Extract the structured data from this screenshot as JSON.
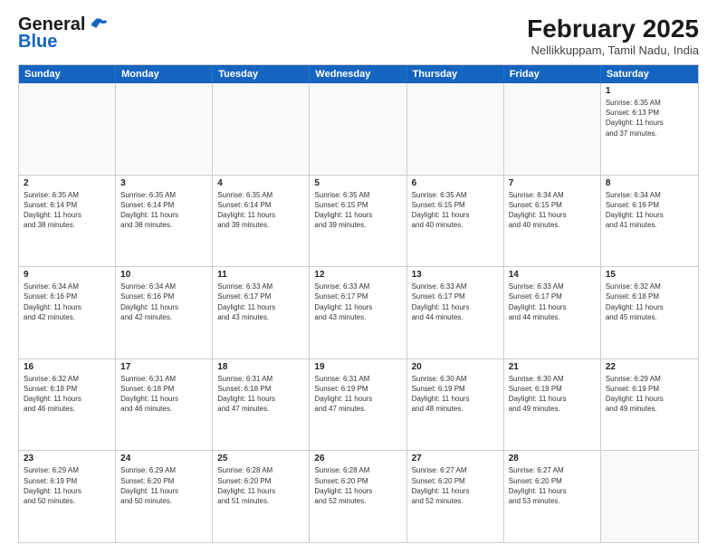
{
  "logo": {
    "line1": "General",
    "line2": "Blue"
  },
  "title": "February 2025",
  "subtitle": "Nellikkuppam, Tamil Nadu, India",
  "header_days": [
    "Sunday",
    "Monday",
    "Tuesday",
    "Wednesday",
    "Thursday",
    "Friday",
    "Saturday"
  ],
  "weeks": [
    [
      {
        "day": "",
        "info": ""
      },
      {
        "day": "",
        "info": ""
      },
      {
        "day": "",
        "info": ""
      },
      {
        "day": "",
        "info": ""
      },
      {
        "day": "",
        "info": ""
      },
      {
        "day": "",
        "info": ""
      },
      {
        "day": "1",
        "info": "Sunrise: 6:35 AM\nSunset: 6:13 PM\nDaylight: 11 hours\nand 37 minutes."
      }
    ],
    [
      {
        "day": "2",
        "info": "Sunrise: 6:35 AM\nSunset: 6:14 PM\nDaylight: 11 hours\nand 38 minutes."
      },
      {
        "day": "3",
        "info": "Sunrise: 6:35 AM\nSunset: 6:14 PM\nDaylight: 11 hours\nand 38 minutes."
      },
      {
        "day": "4",
        "info": "Sunrise: 6:35 AM\nSunset: 6:14 PM\nDaylight: 11 hours\nand 39 minutes."
      },
      {
        "day": "5",
        "info": "Sunrise: 6:35 AM\nSunset: 6:15 PM\nDaylight: 11 hours\nand 39 minutes."
      },
      {
        "day": "6",
        "info": "Sunrise: 6:35 AM\nSunset: 6:15 PM\nDaylight: 11 hours\nand 40 minutes."
      },
      {
        "day": "7",
        "info": "Sunrise: 6:34 AM\nSunset: 6:15 PM\nDaylight: 11 hours\nand 40 minutes."
      },
      {
        "day": "8",
        "info": "Sunrise: 6:34 AM\nSunset: 6:16 PM\nDaylight: 11 hours\nand 41 minutes."
      }
    ],
    [
      {
        "day": "9",
        "info": "Sunrise: 6:34 AM\nSunset: 6:16 PM\nDaylight: 11 hours\nand 42 minutes."
      },
      {
        "day": "10",
        "info": "Sunrise: 6:34 AM\nSunset: 6:16 PM\nDaylight: 11 hours\nand 42 minutes."
      },
      {
        "day": "11",
        "info": "Sunrise: 6:33 AM\nSunset: 6:17 PM\nDaylight: 11 hours\nand 43 minutes."
      },
      {
        "day": "12",
        "info": "Sunrise: 6:33 AM\nSunset: 6:17 PM\nDaylight: 11 hours\nand 43 minutes."
      },
      {
        "day": "13",
        "info": "Sunrise: 6:33 AM\nSunset: 6:17 PM\nDaylight: 11 hours\nand 44 minutes."
      },
      {
        "day": "14",
        "info": "Sunrise: 6:33 AM\nSunset: 6:17 PM\nDaylight: 11 hours\nand 44 minutes."
      },
      {
        "day": "15",
        "info": "Sunrise: 6:32 AM\nSunset: 6:18 PM\nDaylight: 11 hours\nand 45 minutes."
      }
    ],
    [
      {
        "day": "16",
        "info": "Sunrise: 6:32 AM\nSunset: 6:18 PM\nDaylight: 11 hours\nand 46 minutes."
      },
      {
        "day": "17",
        "info": "Sunrise: 6:31 AM\nSunset: 6:18 PM\nDaylight: 11 hours\nand 46 minutes."
      },
      {
        "day": "18",
        "info": "Sunrise: 6:31 AM\nSunset: 6:18 PM\nDaylight: 11 hours\nand 47 minutes."
      },
      {
        "day": "19",
        "info": "Sunrise: 6:31 AM\nSunset: 6:19 PM\nDaylight: 11 hours\nand 47 minutes."
      },
      {
        "day": "20",
        "info": "Sunrise: 6:30 AM\nSunset: 6:19 PM\nDaylight: 11 hours\nand 48 minutes."
      },
      {
        "day": "21",
        "info": "Sunrise: 6:30 AM\nSunset: 6:19 PM\nDaylight: 11 hours\nand 49 minutes."
      },
      {
        "day": "22",
        "info": "Sunrise: 6:29 AM\nSunset: 6:19 PM\nDaylight: 11 hours\nand 49 minutes."
      }
    ],
    [
      {
        "day": "23",
        "info": "Sunrise: 6:29 AM\nSunset: 6:19 PM\nDaylight: 11 hours\nand 50 minutes."
      },
      {
        "day": "24",
        "info": "Sunrise: 6:29 AM\nSunset: 6:20 PM\nDaylight: 11 hours\nand 50 minutes."
      },
      {
        "day": "25",
        "info": "Sunrise: 6:28 AM\nSunset: 6:20 PM\nDaylight: 11 hours\nand 51 minutes."
      },
      {
        "day": "26",
        "info": "Sunrise: 6:28 AM\nSunset: 6:20 PM\nDaylight: 11 hours\nand 52 minutes."
      },
      {
        "day": "27",
        "info": "Sunrise: 6:27 AM\nSunset: 6:20 PM\nDaylight: 11 hours\nand 52 minutes."
      },
      {
        "day": "28",
        "info": "Sunrise: 6:27 AM\nSunset: 6:20 PM\nDaylight: 11 hours\nand 53 minutes."
      },
      {
        "day": "",
        "info": ""
      }
    ]
  ]
}
